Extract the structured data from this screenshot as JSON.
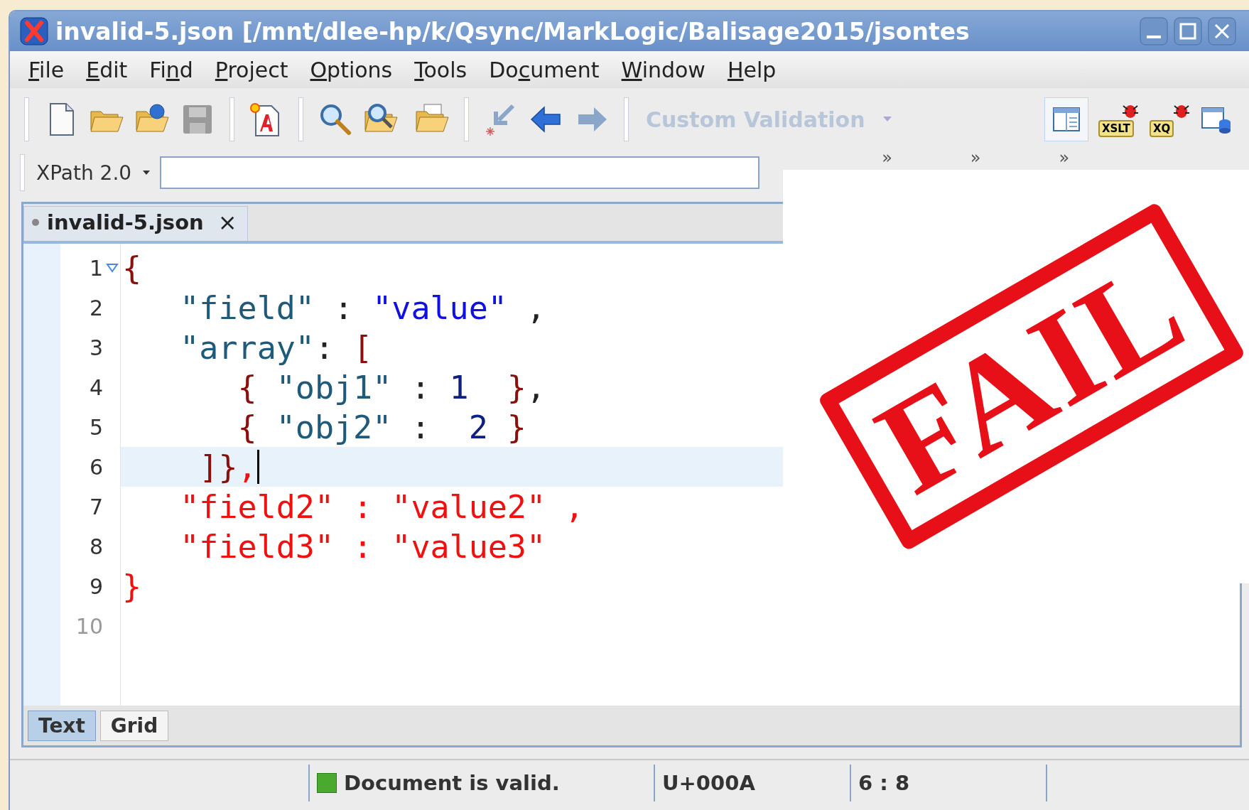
{
  "window": {
    "title": "invalid-5.json [/mnt/dlee-hp/k/Qsync/MarkLogic/Balisage2015/jsontes"
  },
  "menu": [
    {
      "key": "F",
      "post": "ile"
    },
    {
      "key": "E",
      "post": "dit"
    },
    {
      "pre": "Fi",
      "key": "n",
      "post": "d"
    },
    {
      "key": "P",
      "post": "roject"
    },
    {
      "key": "O",
      "post": "ptions"
    },
    {
      "key": "T",
      "post": "ools"
    },
    {
      "pre": "Do",
      "key": "c",
      "post": "ument"
    },
    {
      "key": "W",
      "post": "indow"
    },
    {
      "key": "H",
      "post": "elp"
    }
  ],
  "toolbar": {
    "validation": {
      "label": "Custom Validation",
      "disabled": true
    },
    "debug_labels": [
      "XSLT",
      "XQ"
    ],
    "chevrons": [
      "»",
      "»",
      "»"
    ]
  },
  "xpath": {
    "version": "XPath 2.0"
  },
  "tabs": [
    {
      "label": "invalid-5.json",
      "selected": true,
      "close": "×"
    }
  ],
  "lines": [
    {
      "number": "1",
      "fold": true,
      "current": false,
      "tokens": [
        {
          "kind": "brace",
          "text": "{"
        }
      ]
    },
    {
      "number": "2",
      "fold": false,
      "current": false,
      "tokens": [
        {
          "kind": "key",
          "text": "   \"field\""
        },
        {
          "kind": "punct",
          "text": " : "
        },
        {
          "kind": "string",
          "text": "\"value\""
        },
        {
          "kind": "punct",
          "text": " ,"
        }
      ]
    },
    {
      "number": "3",
      "fold": false,
      "current": false,
      "tokens": [
        {
          "kind": "key",
          "text": "   \"array\""
        },
        {
          "kind": "punct",
          "text": ": "
        },
        {
          "kind": "brace",
          "text": "["
        }
      ]
    },
    {
      "number": "4",
      "fold": false,
      "current": false,
      "tokens": [
        {
          "kind": "brace",
          "text": "      {"
        },
        {
          "kind": "key",
          "text": " \"obj1\""
        },
        {
          "kind": "punct",
          "text": " : "
        },
        {
          "kind": "number",
          "text": "1"
        },
        {
          "kind": "brace",
          "text": "  }"
        },
        {
          "kind": "punct",
          "text": ","
        }
      ]
    },
    {
      "number": "5",
      "fold": false,
      "current": false,
      "tokens": [
        {
          "kind": "brace",
          "text": "      {"
        },
        {
          "kind": "key",
          "text": " \"obj2\""
        },
        {
          "kind": "punct",
          "text": " :  "
        },
        {
          "kind": "number",
          "text": "2"
        },
        {
          "kind": "brace",
          "text": " }"
        }
      ]
    },
    {
      "number": "6",
      "fold": false,
      "current": true,
      "tokens": [
        {
          "kind": "brace",
          "text": "    ]}"
        },
        {
          "kind": "error",
          "text": ","
        }
      ]
    },
    {
      "number": "7",
      "fold": false,
      "current": false,
      "tokens": [
        {
          "kind": "error",
          "text": "   \"field2\" : \"value2\" ,"
        }
      ]
    },
    {
      "number": "8",
      "fold": false,
      "current": false,
      "tokens": [
        {
          "kind": "error",
          "text": "   \"field3\" : \"value3\""
        }
      ]
    },
    {
      "number": "9",
      "fold": false,
      "current": false,
      "tokens": [
        {
          "kind": "error",
          "text": "}"
        }
      ]
    },
    {
      "number": "10",
      "fold": false,
      "current": false
    }
  ],
  "view_tabs": [
    {
      "label": "Text",
      "selected": true
    },
    {
      "label": "Grid",
      "selected": false
    }
  ],
  "stamp": {
    "text": "FAIL"
  },
  "status_bar": {
    "valid": true,
    "message": "Document is valid.",
    "char": "U+000A",
    "position": "6 : 8"
  }
}
